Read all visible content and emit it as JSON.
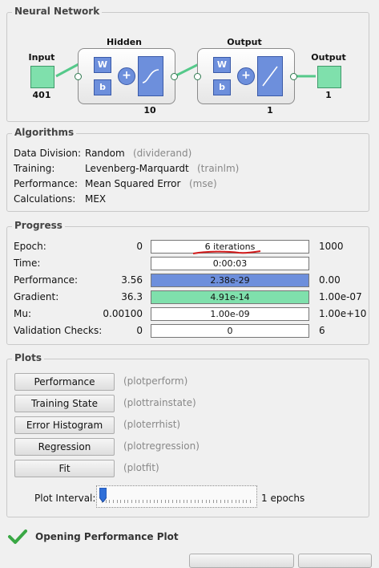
{
  "network": {
    "title": "Neural Network",
    "input_label": "Input",
    "input_size": "401",
    "hidden_label": "Hidden",
    "hidden_size": "10",
    "output_layer_label": "Output",
    "output_layer_size": "1",
    "output_label": "Output",
    "output_size": "1",
    "weight_label": "W",
    "bias_label": "b",
    "sum_symbol": "+"
  },
  "algorithms": {
    "title": "Algorithms",
    "rows": [
      {
        "label": "Data Division:",
        "value": "Random",
        "note": "(dividerand)"
      },
      {
        "label": "Training:",
        "value": "Levenberg-Marquardt",
        "note": "(trainlm)"
      },
      {
        "label": "Performance:",
        "value": "Mean Squared Error",
        "note": "(mse)"
      },
      {
        "label": "Calculations:",
        "value": "MEX",
        "note": ""
      }
    ]
  },
  "progress": {
    "title": "Progress",
    "rows": [
      {
        "label": "Epoch:",
        "start": "0",
        "current": "6 iterations",
        "end": "1000",
        "fill_fraction": 0.0
      },
      {
        "label": "Time:",
        "start": "",
        "current": "0:00:03",
        "end": "",
        "fill_fraction": 0.0
      },
      {
        "label": "Performance:",
        "start": "3.56",
        "current": "2.38e-29",
        "end": "0.00",
        "fill_fraction": 1.0
      },
      {
        "label": "Gradient:",
        "start": "36.3",
        "current": "4.91e-14",
        "end": "1.00e-07",
        "fill_fraction": 1.0
      },
      {
        "label": "Mu:",
        "start": "0.00100",
        "current": "1.00e-09",
        "end": "1.00e+10",
        "fill_fraction": 0.0
      },
      {
        "label": "Validation Checks:",
        "start": "0",
        "current": "0",
        "end": "6",
        "fill_fraction": 0.0
      }
    ]
  },
  "plots": {
    "title": "Plots",
    "buttons": [
      {
        "label": "Performance",
        "function": "(plotperform)"
      },
      {
        "label": "Training State",
        "function": "(plottrainstate)"
      },
      {
        "label": "Error Histogram",
        "function": "(ploterrhist)"
      },
      {
        "label": "Regression",
        "function": "(plotregression)"
      },
      {
        "label": "Fit",
        "function": "(plotfit)"
      }
    ],
    "interval_label": "Plot Interval:",
    "interval_value": "1 epochs",
    "slider_fraction": 0.0
  },
  "status": {
    "message": "Opening Performance Plot"
  },
  "colors": {
    "layer_blue": "#6d8fdc",
    "io_green": "#7fe0ac",
    "annotation_red": "#d11a1a",
    "check_green": "#3aa845"
  }
}
